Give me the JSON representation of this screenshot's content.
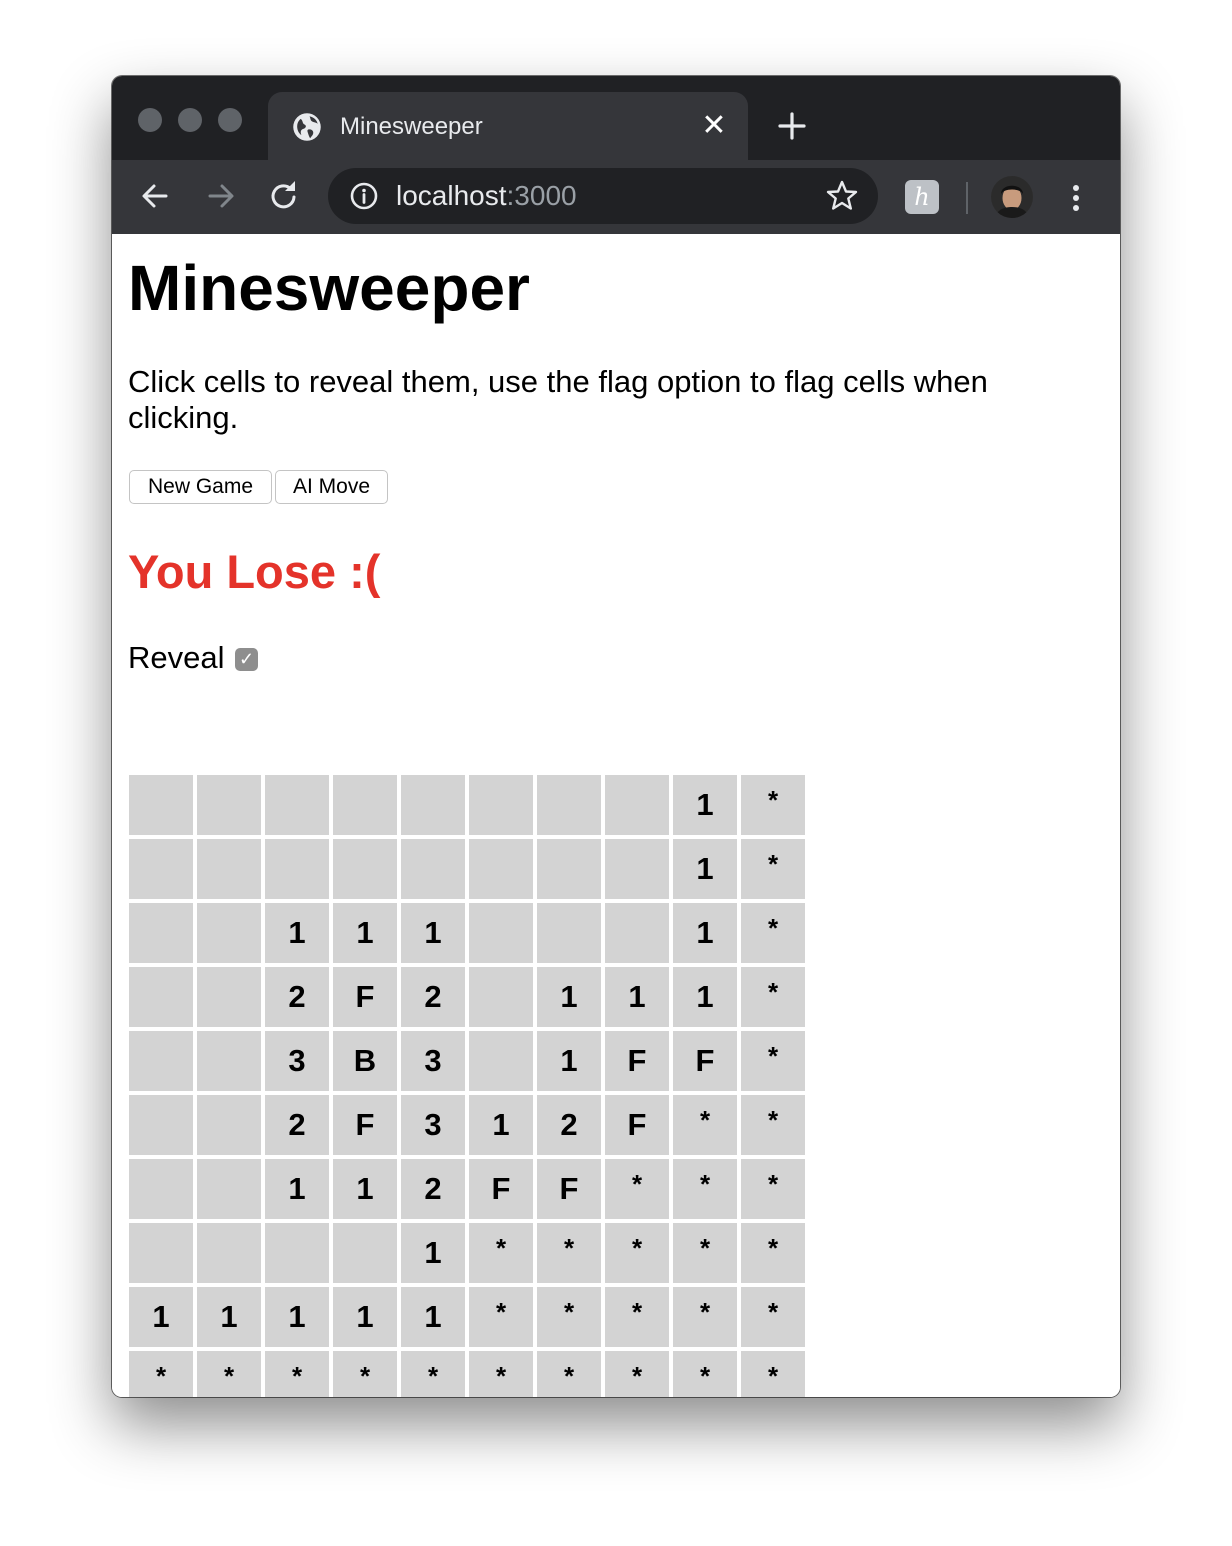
{
  "browser": {
    "tab_title": "Minesweeper",
    "tab_close": "✕",
    "url_host": "localhost",
    "url_port": ":3000",
    "extension_letter": "h"
  },
  "page": {
    "title": "Minesweeper",
    "instructions": "Click cells to reveal them, use the flag option to flag cells when clicking.",
    "new_game_label": "New Game",
    "ai_move_label": "AI Move",
    "status": "You Lose :(",
    "status_color": "#e4332a",
    "reveal_label": "Reveal",
    "reveal_checked": true
  },
  "board": [
    [
      "",
      "",
      "",
      "",
      "",
      "",
      "",
      "",
      "1",
      "*"
    ],
    [
      "",
      "",
      "",
      "",
      "",
      "",
      "",
      "",
      "1",
      "*"
    ],
    [
      "",
      "",
      "1",
      "1",
      "1",
      "",
      "",
      "",
      "1",
      "*"
    ],
    [
      "",
      "",
      "2",
      "F",
      "2",
      "",
      "1",
      "1",
      "1",
      "*"
    ],
    [
      "",
      "",
      "3",
      "B",
      "3",
      "",
      "1",
      "F",
      "F",
      "*"
    ],
    [
      "",
      "",
      "2",
      "F",
      "3",
      "1",
      "2",
      "F",
      "*",
      "*"
    ],
    [
      "",
      "",
      "1",
      "1",
      "2",
      "F",
      "F",
      "*",
      "*",
      "*"
    ],
    [
      "",
      "",
      "",
      "",
      "1",
      "*",
      "*",
      "*",
      "*",
      "*"
    ],
    [
      "1",
      "1",
      "1",
      "1",
      "1",
      "*",
      "*",
      "*",
      "*",
      "*"
    ],
    [
      "*",
      "*",
      "*",
      "*",
      "*",
      "*",
      "*",
      "*",
      "*",
      "*"
    ]
  ]
}
